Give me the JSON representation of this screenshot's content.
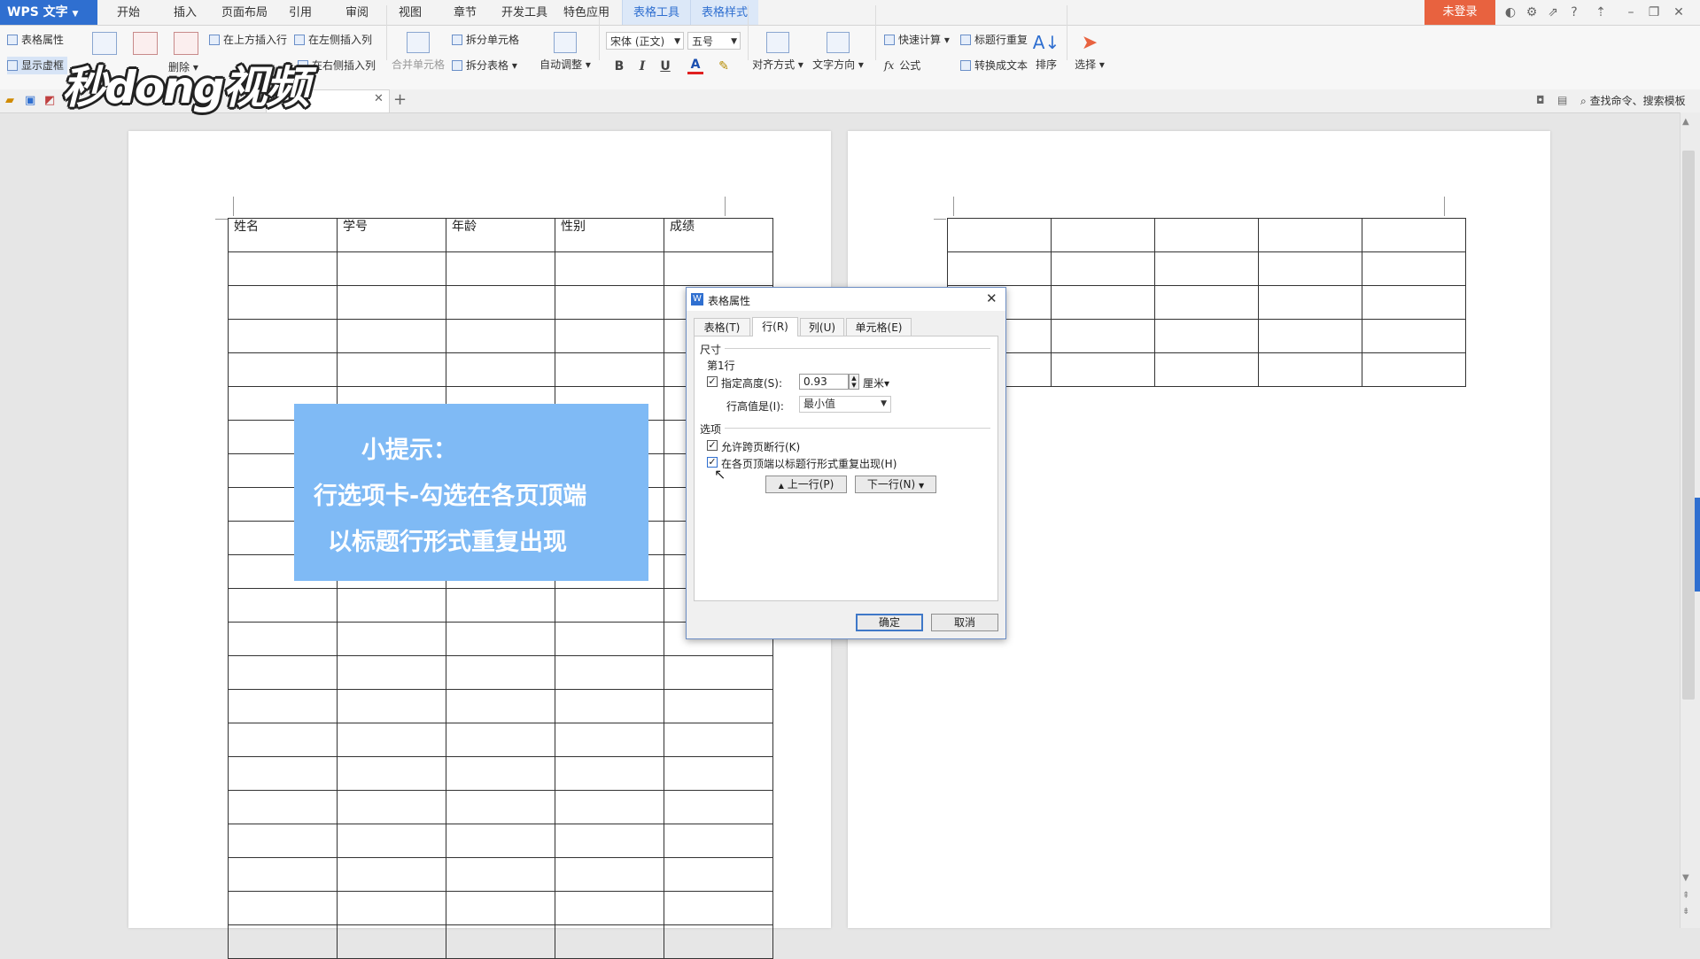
{
  "app": {
    "name": "WPS 文字"
  },
  "menu": {
    "items": [
      "开始",
      "插入",
      "页面布局",
      "引用",
      "审阅",
      "视图",
      "章节",
      "开发工具",
      "特色应用",
      "表格工具",
      "表格样式"
    ],
    "active": "表格工具",
    "login": "未登录"
  },
  "ribbon": {
    "table_props": "表格属性",
    "show_grid": "显示虚框",
    "delete": "删除",
    "insert_above": "在上方插入行",
    "insert_left": "在左侧插入列",
    "insert_right": "在右侧插入列",
    "merge_cells": "合并单元格",
    "split_cell": "拆分单元格",
    "split_table": "拆分表格",
    "auto_fit": "自动调整",
    "font": "宋体 (正文)",
    "font_size": "五号",
    "bold": "B",
    "italic": "I",
    "underline": "U",
    "font_color": "A",
    "align": "对齐方式",
    "text_dir": "文字方向",
    "quick_calc": "快速计算",
    "formula": "公式",
    "repeat_header": "标题行重复",
    "to_text": "转换成文本",
    "sort": "排序",
    "select": "选择",
    "search": "查找命令、搜索模板"
  },
  "watermark": "秒dong视频",
  "table": {
    "headers": [
      "姓名",
      "学号",
      "年龄",
      "性别",
      "成绩"
    ]
  },
  "tip": {
    "line1": "小提示：",
    "line2": "行选项卡-勾选在各页顶端",
    "line3": "以标题行形式重复出现"
  },
  "dialog": {
    "title": "表格属性",
    "tabs": [
      "表格(T)",
      "行(R)",
      "列(U)",
      "单元格(E)"
    ],
    "active_tab": "行(R)",
    "size_group": "尺寸",
    "row_label": "第1行",
    "specify_height_label": "指定高度(S):",
    "specify_height_checked": true,
    "height_value": "0.93",
    "unit": "厘米",
    "row_height_is_label": "行高值是(I):",
    "row_height_is_value": "最小值",
    "options_group": "选项",
    "allow_break_label": "允许跨页断行(K)",
    "allow_break_checked": true,
    "repeat_header_label": "在各页顶端以标题行形式重复出现(H)",
    "repeat_header_checked": true,
    "prev_row": "上一行(P)",
    "next_row": "下一行(N)",
    "ok": "确定",
    "cancel": "取消"
  }
}
